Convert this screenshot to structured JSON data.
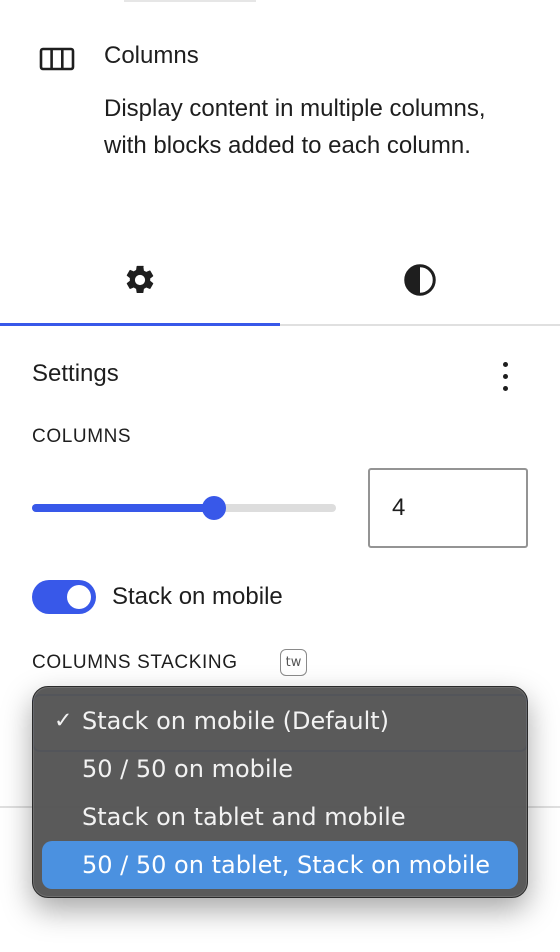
{
  "block": {
    "title": "Columns",
    "description": "Display content in multiple columns, with blocks added to each column.",
    "icon": "columns-icon"
  },
  "tabs": [
    {
      "name": "settings",
      "icon": "gear-icon",
      "selected": true
    },
    {
      "name": "styles",
      "icon": "half-circle-contrast-icon",
      "selected": false
    }
  ],
  "panel": {
    "title": "Settings",
    "menu_icon": "kebab-vertical-icon"
  },
  "columns": {
    "label": "COLUMNS",
    "value": "4",
    "slider_fraction": 0.6
  },
  "stack_toggle": {
    "label": "Stack on mobile",
    "on": true
  },
  "stacking": {
    "label": "COLUMNS STACKING",
    "badge": "tw"
  },
  "dropdown": {
    "options": [
      {
        "label": "Stack on mobile (Default)",
        "checked": true,
        "highlighted": false
      },
      {
        "label": "50 / 50 on mobile",
        "checked": false,
        "highlighted": false
      },
      {
        "label": "Stack on tablet and mobile",
        "checked": false,
        "highlighted": false
      },
      {
        "label": "50 / 50 on tablet, Stack on mobile",
        "checked": false,
        "highlighted": true
      }
    ],
    "check_glyph": "✓"
  },
  "colors": {
    "accent": "#3858e9",
    "menu_bg": "#555555",
    "menu_highlight": "#4b91e0"
  }
}
